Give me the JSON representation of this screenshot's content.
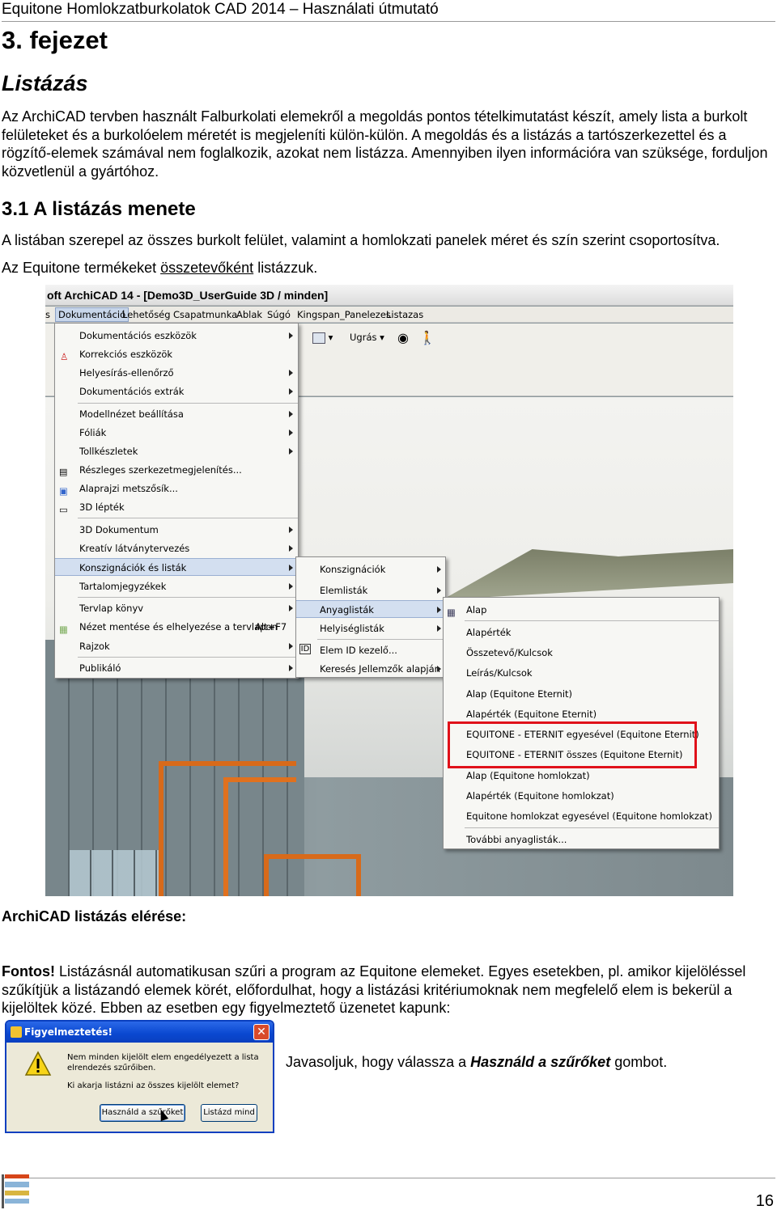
{
  "header": {
    "running_title": "Equitone Homlokzatburkolatok CAD 2014 – Használati útmutató"
  },
  "chapter": "3. fejezet",
  "section_title": "Listázás",
  "intro_paragraph": "Az ArchiCAD tervben használt Falburkolati elemekről a megoldás pontos tételkimutatást készít, amely lista a burkolt felületeket és a burkolóelem méretét is megjeleníti külön-külön. A megoldás és a listázás a tartószerkezettel és a rögzítő-elemek számával nem foglalkozik, azokat nem listázza. Amennyiben ilyen információra van szüksége, forduljon közvetlenül a gyártóhoz.",
  "subsection_title": "3.1 A listázás menete",
  "para2": "A listában szerepel az összes burkolt felület, valamint a homlokzati panelek méret és szín szerint csoportosítva.",
  "para3": {
    "before": "Az Equitone termékeket ",
    "underlined": "összetevőként",
    "after": " listázzuk."
  },
  "screenshot": {
    "window_title": "oft ArchiCAD 14 - [Demo3D_UserGuide 3D / minden]",
    "menubar": [
      "s",
      "Dokumentáció",
      "Lehetőség",
      "Csapatmunka",
      "Ablak",
      "Súgó",
      "Kingspan_Panelezes",
      "Listazas"
    ],
    "toolbar_label": "Ugrás",
    "menu1": [
      {
        "label": "Dokumentációs eszközök",
        "arrow": true
      },
      {
        "label": "Korrekciós eszközök",
        "arrow": false
      },
      {
        "label": "Helyesírás-ellenőrző",
        "arrow": true
      },
      {
        "label": "Dokumentációs extrák",
        "arrow": true
      },
      {
        "label": "Modellnézet beállítása",
        "arrow": true
      },
      {
        "label": "Fóliák",
        "arrow": true
      },
      {
        "label": "Tollkészletek",
        "arrow": true
      },
      {
        "label": "Részleges szerkezetmegjelenítés...",
        "arrow": false
      },
      {
        "label": "Alaprajzi metszősík...",
        "arrow": false
      },
      {
        "label": "3D lépték",
        "arrow": false
      },
      {
        "label": "3D Dokumentum",
        "arrow": true
      },
      {
        "label": "Kreatív látványtervezés",
        "arrow": true
      },
      {
        "label": "Konszignációk és listák",
        "arrow": true
      },
      {
        "label": "Tartalomjegyzékek",
        "arrow": true
      },
      {
        "label": "Tervlap könyv",
        "arrow": true
      },
      {
        "label": "Nézet mentése és elhelyezése a tervlapon",
        "shortcut": "Alt+F7",
        "arrow": false
      },
      {
        "label": "Rajzok",
        "arrow": true
      },
      {
        "label": "Publikáló",
        "arrow": true
      }
    ],
    "menu2": [
      {
        "label": "Konszignációk",
        "arrow": true
      },
      {
        "label": "Elemlisták",
        "arrow": true
      },
      {
        "label": "Anyaglisták",
        "arrow": true
      },
      {
        "label": "Helyiséglisták",
        "arrow": true
      },
      {
        "label": "Elem ID kezelő...",
        "arrow": false
      },
      {
        "label": "Keresés Jellemzők alapján",
        "arrow": true
      }
    ],
    "menu3": [
      "Alap",
      "Alapérték",
      "Összetevő/Kulcsok",
      "Leírás/Kulcsok",
      "Alap (Equitone Eternit)",
      "Alapérték (Equitone Eternit)",
      "EQUITONE - ETERNIT egyesével (Equitone Eternit)",
      "EQUITONE - ETERNIT összes (Equitone Eternit)",
      "Alap (Equitone homlokzat)",
      "Alapérték (Equitone homlokzat)",
      "Equitone homlokzat egyesével (Equitone homlokzat)",
      "További anyaglisták..."
    ],
    "highlight_color": "#e0111a"
  },
  "figure_caption": "ArchiCAD listázás elérése:",
  "note": {
    "bold": "Fontos!",
    "text": " Listázásnál automatikusan szűri a program az Equitone elemeket. Egyes esetekben, pl. amikor kijelöléssel szűkítjük a listázandó elemek körét, előfordulhat, hogy a listázási kritériumoknak nem megfelelő elem is bekerül a kijelöltek közé. Ebben az esetben egy figyelmeztető üzenetet kapunk:"
  },
  "dialog": {
    "title": "Figyelmeztetés!",
    "close": "✕",
    "message1": "Nem minden kijelölt elem engedélyezett a lista elrendezés szűrőiben.",
    "message2": "Ki akarja listázni az összes kijelölt elemet?",
    "button_primary": "Használd a szűrőket",
    "button_secondary": "Listázd mind"
  },
  "recommendation": {
    "before": "Javasoljuk, hogy válassza a ",
    "bold": "Használd a szűrőket",
    "after": " gombot."
  },
  "footer": {
    "page_number": "16"
  }
}
